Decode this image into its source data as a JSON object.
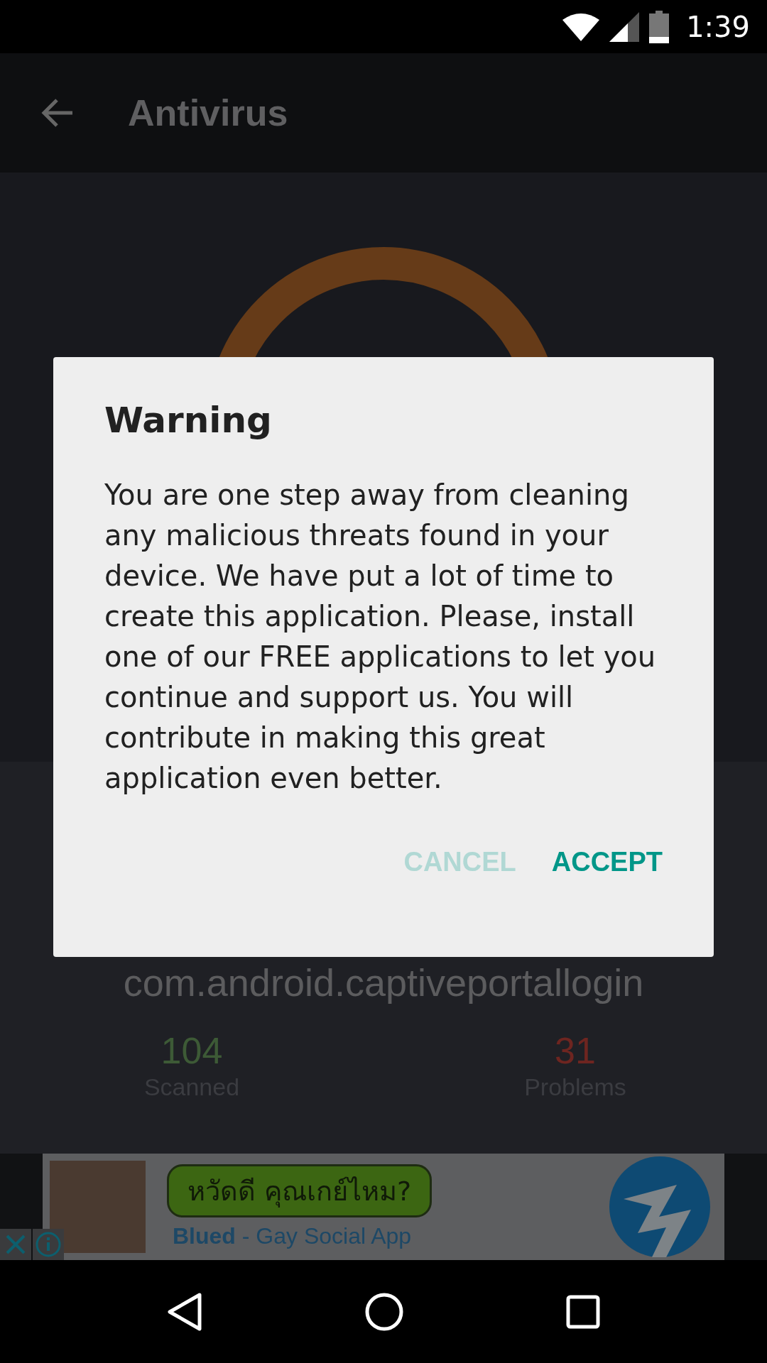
{
  "status_bar": {
    "time": "1:39"
  },
  "toolbar": {
    "title": "Antivirus"
  },
  "scan": {
    "package": "com.android.captiveportallogin",
    "stats": [
      {
        "kind": "scanned",
        "value": "104",
        "label": "Scanned"
      },
      {
        "kind": "problems",
        "value": "31",
        "label": "Problems"
      }
    ]
  },
  "dialog": {
    "title": "Warning",
    "message": "You are one step away from cleaning any malicious threats found in your device. We have put a lot of time to create this application. Please, install one of our FREE applications to let you continue and support us. You will contribute in making this great application even better.",
    "buttons": [
      {
        "label": "CANCEL",
        "disabled": true
      },
      {
        "label": "ACCEPT",
        "disabled": false
      }
    ]
  },
  "ad": {
    "bubble": "หวัดดี คุณเกย์ไหม?",
    "brand": "Blued",
    "tagline": " - Gay Social App"
  }
}
